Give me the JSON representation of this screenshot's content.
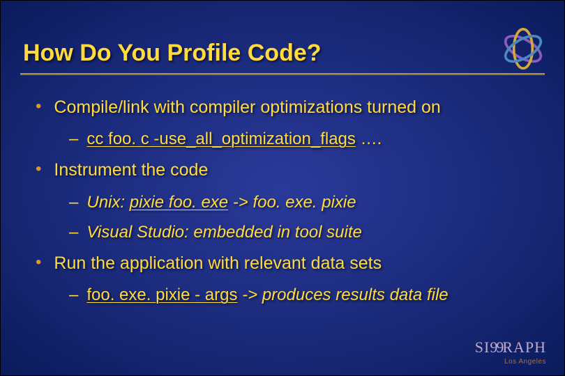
{
  "title": "How Do You Profile Code?",
  "bullets": {
    "b1a": "Compile/link with compiler optimizations turned on",
    "b2a_u": "cc foo. c -use_all_optimization_flags",
    "b2a_tail": " ….",
    "b1b": "Instrument the code",
    "b2b_prefix": "Unix: ",
    "b2b_u": " pixie foo. exe",
    "b2b_tail": " -> foo. exe. pixie",
    "b2c": "Visual Studio: embedded in tool suite",
    "b1c": "Run the application with relevant data sets",
    "b2d_u": "foo. exe. pixie - args",
    "b2d_tail": "  -> produces results data file"
  },
  "footer": {
    "brand_left": "SI",
    "brand_mid": "99",
    "brand_right": "RAPH",
    "location": "Los Angeles"
  }
}
